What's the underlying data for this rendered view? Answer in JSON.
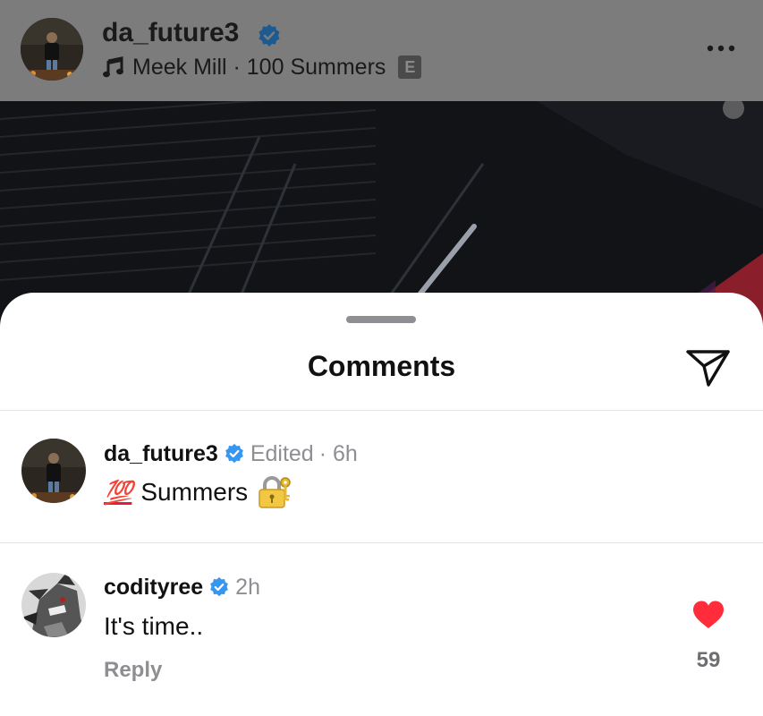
{
  "post": {
    "username": "da_future3",
    "song": "Meek Mill · 100 Summers",
    "explicit_badge": "E",
    "verified": true
  },
  "sheet": {
    "title": "Comments"
  },
  "comments": [
    {
      "username": "da_future3",
      "verified": true,
      "status": "Edited",
      "time": "· 6h",
      "emoji": "💯",
      "text": "Summers",
      "lock_emoji": "🔐"
    },
    {
      "username": "codityree",
      "verified": true,
      "time": "2h",
      "text": "It's time..",
      "reply_label": "Reply",
      "likes": "59"
    }
  ],
  "colors": {
    "verified_blue": "#3797f0",
    "like_red": "#ff2d3b",
    "secondary_text": "#8e8e93"
  }
}
